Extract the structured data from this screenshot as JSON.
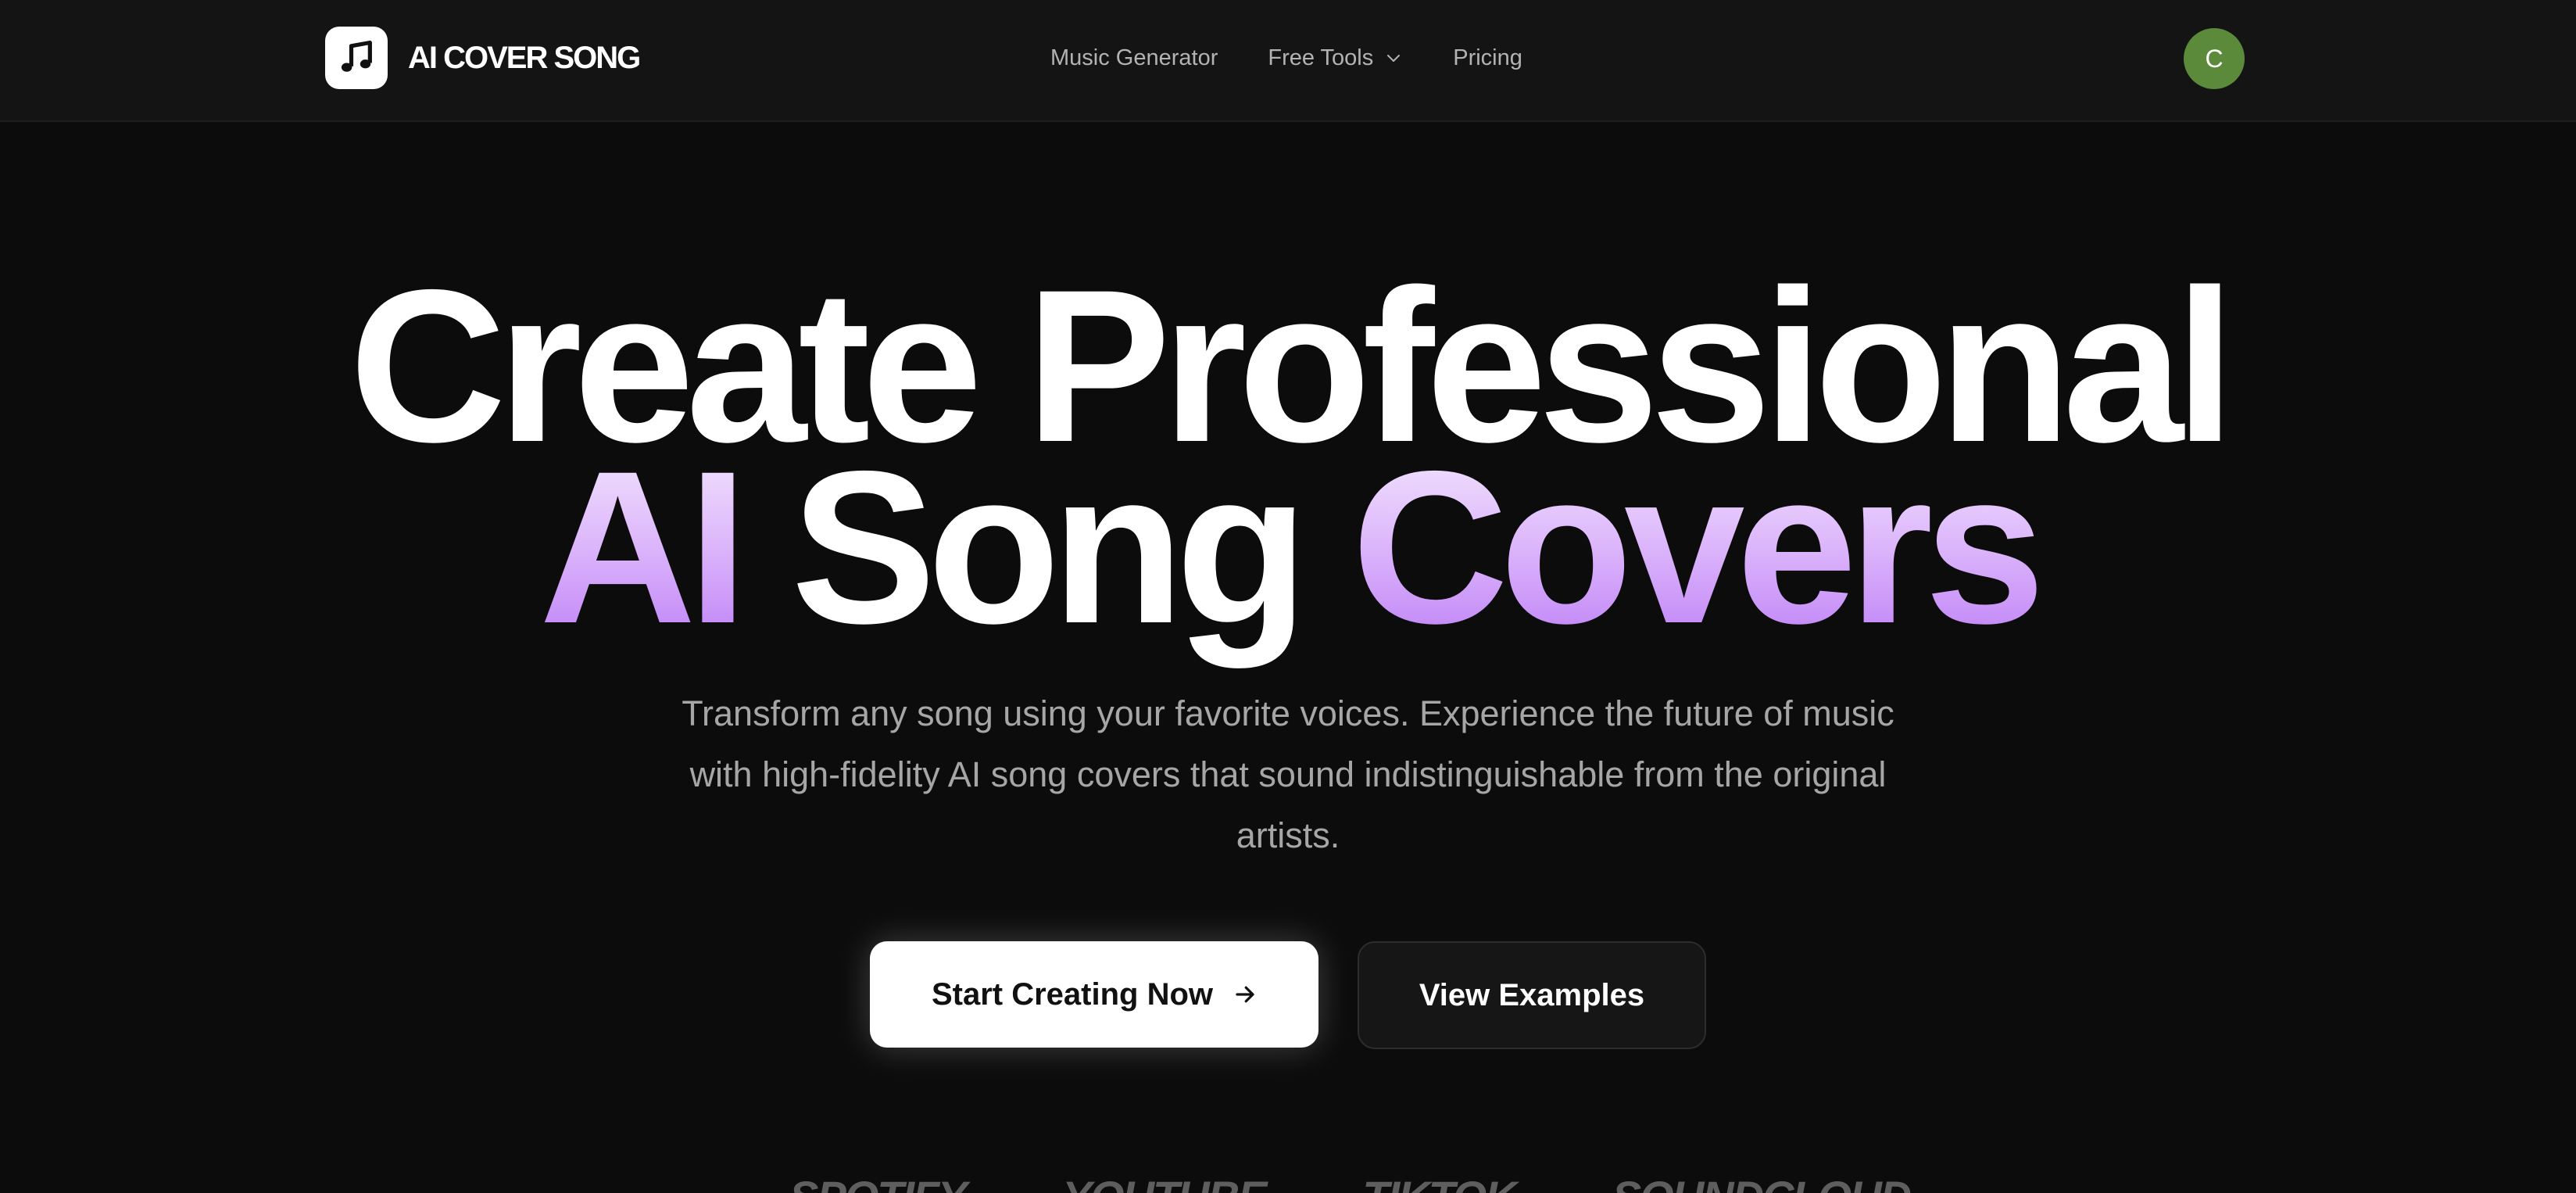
{
  "brand": {
    "name": "AI COVER SONG",
    "logo_icon": "music-note-icon"
  },
  "nav": {
    "links": [
      "Music Generator",
      "Free Tools",
      "Pricing"
    ],
    "dropdown_icon": "chevron-down-icon"
  },
  "user": {
    "initial": "C",
    "avatar_color": "#5b8a3a"
  },
  "hero": {
    "title_line1": "Create Professional",
    "title_line2_part1": "AI",
    "title_line2_part2": "Song",
    "title_line2_part3": "Covers",
    "subtitle": "Transform any song using your favorite voices. Experience the future of music with high-fidelity AI song covers that sound indistinguishable from the original artists."
  },
  "cta": {
    "primary_label": "Start Creating Now",
    "primary_icon": "arrow-right-icon",
    "secondary_label": "View Examples"
  },
  "platforms": [
    "SPOTIFY",
    "YOUTUBE",
    "TIKTOK",
    "SOUNDCLOUD"
  ],
  "colors": {
    "background": "#0c0c0c",
    "navbar": "#141414",
    "accent_gradient": [
      "#f6eefe",
      "#dcb5fb",
      "#b978f5"
    ]
  }
}
